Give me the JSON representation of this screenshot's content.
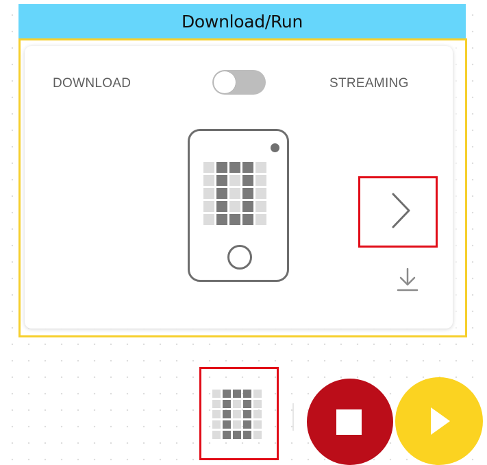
{
  "header": {
    "title": "Download/Run"
  },
  "panel": {
    "mode_left_label": "DOWNLOAD",
    "mode_right_label": "STREAMING",
    "toggle_state": "download"
  },
  "device": {
    "led_matrix": [
      [
        0,
        1,
        1,
        1,
        0
      ],
      [
        0,
        1,
        0,
        1,
        0
      ],
      [
        0,
        1,
        0,
        1,
        0
      ],
      [
        0,
        1,
        0,
        1,
        0
      ],
      [
        0,
        1,
        1,
        1,
        0
      ]
    ]
  },
  "icons": {
    "next": "chevron-right-icon",
    "download": "download-icon",
    "stop": "stop-icon",
    "play": "play-icon"
  },
  "colors": {
    "header_bg": "#66d6fb",
    "highlight_panel": "#f6cf2c",
    "highlight_control": "#e10d18",
    "stop_button": "#bb0d19",
    "play_button": "#fbd321",
    "led_on": "#7a7a7a",
    "led_off": "#dcdcdc"
  }
}
